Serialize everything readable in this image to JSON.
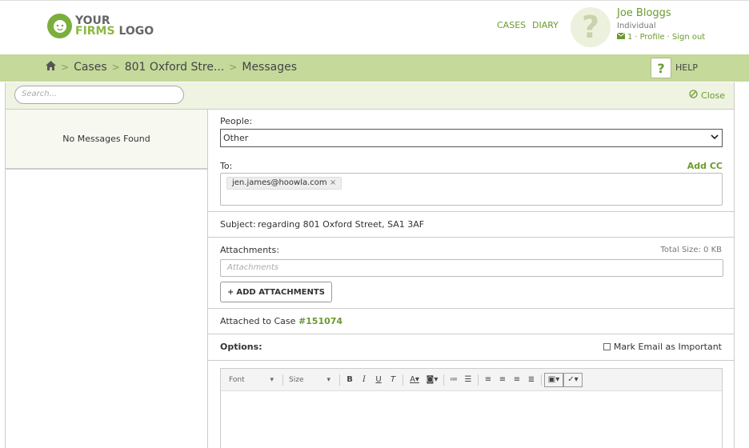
{
  "logo": {
    "line1": "YOUR",
    "line2a": "FIRMS",
    "line2b": "LOGO"
  },
  "nav": {
    "cases": "CASES",
    "diary": "DIARY"
  },
  "user": {
    "name": "Joe Bloggs",
    "role": "Individual",
    "message_count": "1",
    "profile": "Profile",
    "signout": "Sign out",
    "avatar_glyph": "?"
  },
  "breadcrumb": {
    "cases": "Cases",
    "case": "801 Oxford Stre...",
    "current": "Messages",
    "sep": ">"
  },
  "help": {
    "icon": "?",
    "label": "HELP"
  },
  "search": {
    "placeholder": "Search..."
  },
  "close": {
    "label": "Close"
  },
  "messages": {
    "empty": "No Messages Found"
  },
  "form": {
    "people_label": "People:",
    "people_value": "Other",
    "to_label": "To:",
    "add_cc": "Add CC",
    "to_tag": "jen.james@hoowla.com",
    "subject_label": "Subject:",
    "subject_value": "regarding 801 Oxford Street, SA1 3AF",
    "attachments_label": "Attachments:",
    "total_size": "Total Size:  0 KB",
    "attachments_placeholder": "Attachments",
    "add_attachments": "ADD ATTACHMENTS",
    "attached_to": "Attached to Case",
    "case_number": "#151074",
    "options_label": "Options:",
    "mark_important": "Mark Email as Important"
  },
  "editor": {
    "font": "Font",
    "size": "Size"
  },
  "colors": {
    "accent": "#6c9a2e",
    "bar": "#c5d99b",
    "panel": "#eef3e2"
  }
}
